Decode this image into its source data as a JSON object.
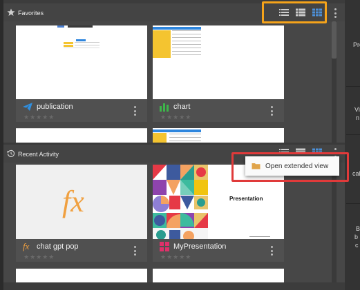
{
  "favorites": {
    "title": "Favorites",
    "items": [
      {
        "name": "publication",
        "icon": "paper-plane-icon",
        "rating": "★★★★★"
      },
      {
        "name": "chart",
        "icon": "bar-chart-icon",
        "rating": "★★★★★"
      }
    ]
  },
  "recent": {
    "title": "Recent Activity",
    "items": [
      {
        "name": "chat gpt pop",
        "icon": "fx-icon",
        "preview_text": "fx",
        "rating": "★★★★★"
      },
      {
        "name": "MyPresentation",
        "icon": "presentation-grid-icon",
        "preview_title": "Presentation",
        "rating": "★★★★★"
      }
    ]
  },
  "context_menu": {
    "items": [
      {
        "label": "Open extended view",
        "icon": "folder-icon"
      }
    ]
  },
  "right_panel": {
    "labels": [
      "Pre",
      "Vi",
      "n",
      "cal",
      "B",
      "b",
      "c"
    ]
  },
  "colors": {
    "highlight_orange": "#f5a31a",
    "highlight_red": "#e03a3a",
    "active_view_blue": "#3b7fc4",
    "chart_green": "#3db54a",
    "fx_orange": "#f0a040"
  }
}
